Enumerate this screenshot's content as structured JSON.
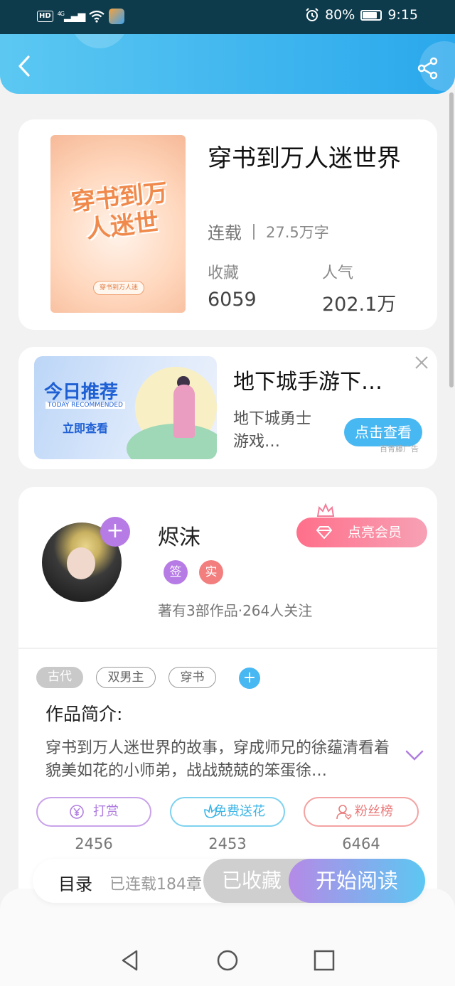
{
  "status_bar": {
    "hd": "HD",
    "network": "4G",
    "battery_percent": 80,
    "battery_text": "80%",
    "time": "9:15"
  },
  "header": {
    "back_icon": "chevron-left-icon",
    "share_icon": "share-icon",
    "accent_color": "#2aa8ec"
  },
  "book": {
    "cover_title": "穿书到万人迷世",
    "cover_sub": "穿书到万人迷",
    "title": "穿书到万人迷世界",
    "status": "连载",
    "word_count": "27.5万字",
    "collect_label": "收藏",
    "collect_value": "6059",
    "popularity_label": "人气",
    "popularity_value": "202.1万"
  },
  "ad": {
    "image_title": "今日推荐",
    "image_subtitle": "TODAY RECOMMENDED",
    "image_cta": "立即查看",
    "title": "地下城手游下…",
    "description": "地下城勇士游戏…",
    "button": "点击查看",
    "source": "百青藤广告"
  },
  "author": {
    "name": "烬沫",
    "badge_sign": "签",
    "badge_real": "实",
    "meta": "著有3部作品·264人关注",
    "vip_button": "点亮会员"
  },
  "tags": [
    "古代",
    "双男主",
    "穿书"
  ],
  "intro": {
    "title": "作品简介:",
    "text": "穿书到万人迷世界的故事，穿成师兄的徐蕴清看着貌美如花的小师弟，战战兢兢的笨蛋徐…"
  },
  "actions": {
    "reward_label": "打赏",
    "reward_count": "2456",
    "flower_label": "免费送花",
    "flower_count": "2453",
    "fans_label": "粉丝榜",
    "fans_count": "6464"
  },
  "bottom": {
    "toc": "目录",
    "chapters": "已连载184章",
    "collected": "已收藏",
    "read": "开始阅读"
  }
}
